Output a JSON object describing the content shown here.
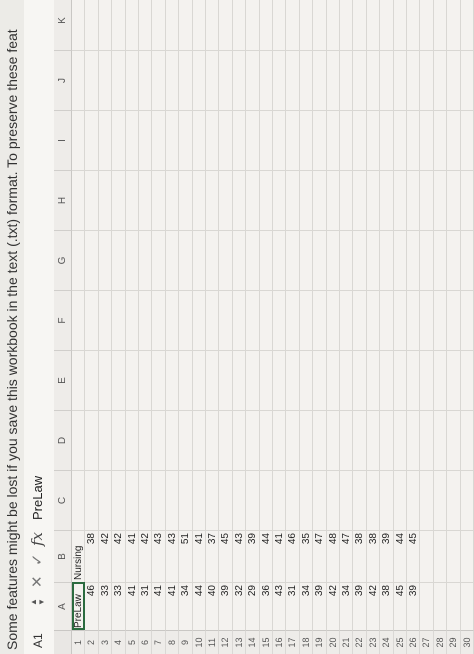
{
  "message_bar": {
    "text": "Some features might be lost if you save this workbook in the text (.txt) format. To preserve these feat"
  },
  "formula_bar": {
    "name_box": "A1",
    "cancel_glyph": "✕",
    "enter_glyph": "✓",
    "fx_label": "fx",
    "formula_value": "PreLaw"
  },
  "columns": [
    "A",
    "B",
    "C",
    "D",
    "E",
    "F",
    "G",
    "H",
    "I",
    "J",
    "K"
  ],
  "rows": [
    {
      "row": "1",
      "a": "PreLaw",
      "b": "Nursing"
    },
    {
      "row": "2",
      "a": "46",
      "b": "38"
    },
    {
      "row": "3",
      "a": "33",
      "b": "42"
    },
    {
      "row": "4",
      "a": "33",
      "b": "42"
    },
    {
      "row": "5",
      "a": "41",
      "b": "41"
    },
    {
      "row": "6",
      "a": "31",
      "b": "42"
    },
    {
      "row": "7",
      "a": "41",
      "b": "43"
    },
    {
      "row": "8",
      "a": "41",
      "b": "43"
    },
    {
      "row": "9",
      "a": "34",
      "b": "51"
    },
    {
      "row": "10",
      "a": "44",
      "b": "41"
    },
    {
      "row": "11",
      "a": "40",
      "b": "37"
    },
    {
      "row": "12",
      "a": "39",
      "b": "45"
    },
    {
      "row": "13",
      "a": "32",
      "b": "43"
    },
    {
      "row": "14",
      "a": "29",
      "b": "39"
    },
    {
      "row": "15",
      "a": "36",
      "b": "44"
    },
    {
      "row": "16",
      "a": "43",
      "b": "41"
    },
    {
      "row": "17",
      "a": "31",
      "b": "46"
    },
    {
      "row": "18",
      "a": "34",
      "b": "35"
    },
    {
      "row": "19",
      "a": "39",
      "b": "47"
    },
    {
      "row": "20",
      "a": "42",
      "b": "48"
    },
    {
      "row": "21",
      "a": "34",
      "b": "47"
    },
    {
      "row": "22",
      "a": "39",
      "b": "38"
    },
    {
      "row": "23",
      "a": "42",
      "b": "38"
    },
    {
      "row": "24",
      "a": "38",
      "b": "39"
    },
    {
      "row": "25",
      "a": "45",
      "b": "44"
    },
    {
      "row": "26",
      "a": "39",
      "b": "45"
    },
    {
      "row": "27",
      "a": "",
      "b": ""
    },
    {
      "row": "28",
      "a": "",
      "b": ""
    },
    {
      "row": "29",
      "a": "",
      "b": ""
    },
    {
      "row": "30",
      "a": "",
      "b": ""
    }
  ],
  "colors": {
    "selection": "#2b6b3f",
    "grid": "#d9d7d3",
    "header_bg": "#eeece9"
  }
}
